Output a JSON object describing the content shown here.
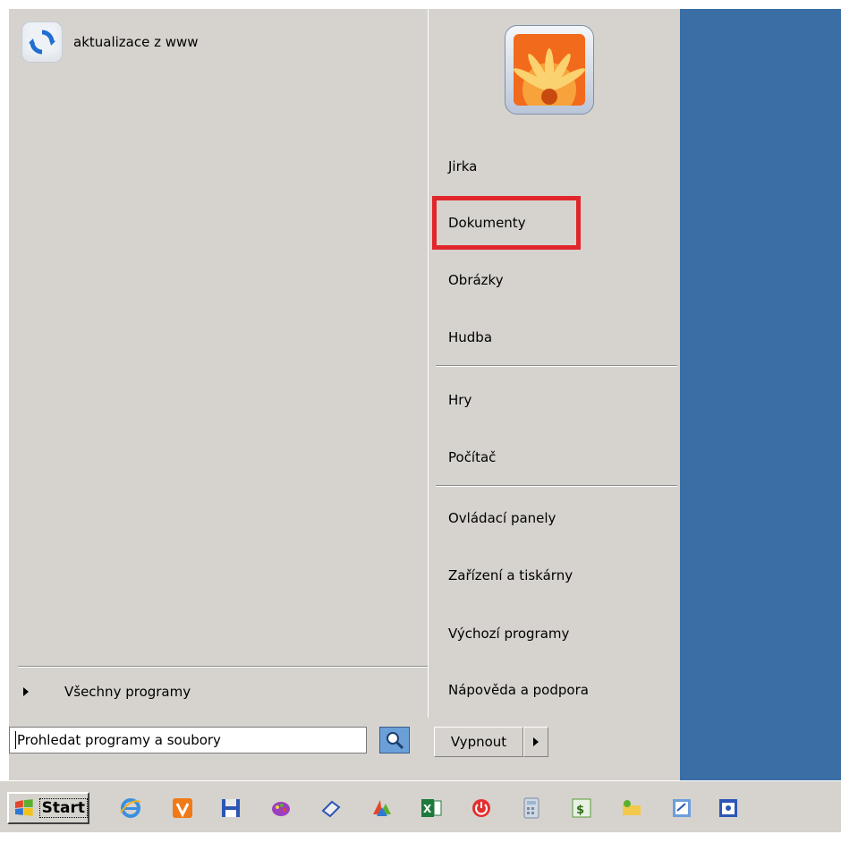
{
  "pinned": [
    {
      "label": "aktualizace z www",
      "icon": "refresh-icon"
    }
  ],
  "all_programs": {
    "label": "Všechny programy"
  },
  "search": {
    "placeholder": "Prohledat programy a soubory"
  },
  "right_items": {
    "user": "Jirka",
    "documents": "Dokumenty",
    "pictures": "Obrázky",
    "music": "Hudba",
    "games": "Hry",
    "computer": "Počítač",
    "control_panel": "Ovládací panely",
    "devices": "Zařízení a tiskárny",
    "defaults": "Výchozí programy",
    "help": "Nápověda a podpora"
  },
  "shutdown": {
    "label": "Vypnout"
  },
  "taskbar": {
    "start_label": "Start",
    "quick_launch": [
      "ie-icon",
      "avast-icon",
      "save-disk-icon",
      "paint-icon",
      "eraser-icon",
      "mixer-icon",
      "excel-icon",
      "power-icon",
      "calculator-icon",
      "spreadsheet-icon",
      "folder-icon",
      "notepad-icon",
      "window-icon"
    ]
  },
  "colors": {
    "menu_bg": "#d6d3ce",
    "desktop_blue": "#3a6ea5",
    "highlight_red": "#e0262b"
  }
}
